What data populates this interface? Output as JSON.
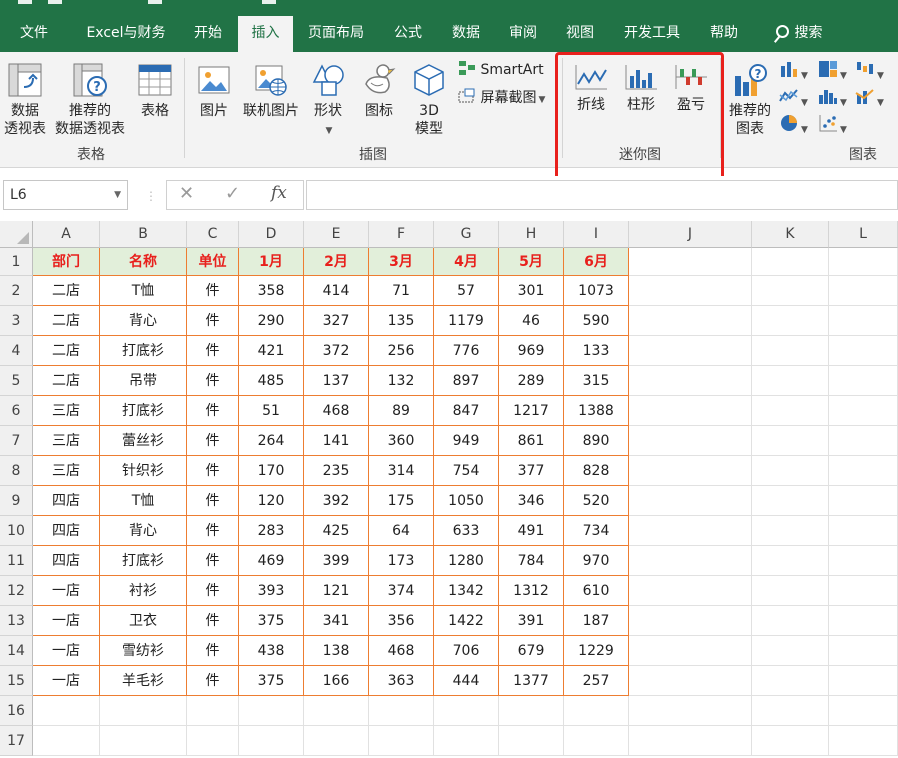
{
  "menu": {
    "tabs": [
      "文件",
      "Excel与财务",
      "开始",
      "插入",
      "页面布局",
      "公式",
      "数据",
      "审阅",
      "视图",
      "开发工具",
      "帮助",
      "搜索"
    ],
    "active_tab": "插入"
  },
  "ribbon": {
    "table_group": {
      "label": "表格",
      "pivot": "数据\n透视表",
      "recommended_pivot": "推荐的\n数据透视表",
      "table": "表格"
    },
    "illustrations_group": {
      "label": "插图",
      "picture": "图片",
      "online_picture": "联机图片",
      "shapes": "形状",
      "icons": "图标",
      "model3d": "3D\n模型",
      "smartart": "SmartArt",
      "screenshot": "屏幕截图"
    },
    "sparklines_group": {
      "label": "迷你图",
      "line": "折线",
      "column": "柱形",
      "winloss": "盈亏"
    },
    "charts_group": {
      "label": "图表",
      "recommended": "推荐的\n图表"
    }
  },
  "formula_bar": {
    "name_box": "L6",
    "fx": "fx",
    "cancel": "✕",
    "confirm": "✓",
    "value": ""
  },
  "sheet": {
    "columns": [
      "A",
      "B",
      "C",
      "D",
      "E",
      "F",
      "G",
      "H",
      "I",
      "J",
      "K",
      "L"
    ],
    "row_numbers": [
      "1",
      "2",
      "3",
      "4",
      "5",
      "6",
      "7",
      "8",
      "9",
      "10",
      "11",
      "12",
      "13",
      "14",
      "15",
      "16",
      "17"
    ],
    "header": [
      "部门",
      "名称",
      "单位",
      "1月",
      "2月",
      "3月",
      "4月",
      "5月",
      "6月"
    ],
    "rows": [
      [
        "二店",
        "T恤",
        "件",
        "358",
        "414",
        "71",
        "57",
        "301",
        "1073"
      ],
      [
        "二店",
        "背心",
        "件",
        "290",
        "327",
        "135",
        "1179",
        "46",
        "590"
      ],
      [
        "二店",
        "打底衫",
        "件",
        "421",
        "372",
        "256",
        "776",
        "969",
        "133"
      ],
      [
        "二店",
        "吊带",
        "件",
        "485",
        "137",
        "132",
        "897",
        "289",
        "315"
      ],
      [
        "三店",
        "打底衫",
        "件",
        "51",
        "468",
        "89",
        "847",
        "1217",
        "1388"
      ],
      [
        "三店",
        "蕾丝衫",
        "件",
        "264",
        "141",
        "360",
        "949",
        "861",
        "890"
      ],
      [
        "三店",
        "针织衫",
        "件",
        "170",
        "235",
        "314",
        "754",
        "377",
        "828"
      ],
      [
        "四店",
        "T恤",
        "件",
        "120",
        "392",
        "175",
        "1050",
        "346",
        "520"
      ],
      [
        "四店",
        "背心",
        "件",
        "283",
        "425",
        "64",
        "633",
        "491",
        "734"
      ],
      [
        "四店",
        "打底衫",
        "件",
        "469",
        "399",
        "173",
        "1280",
        "784",
        "970"
      ],
      [
        "一店",
        "衬衫",
        "件",
        "393",
        "121",
        "374",
        "1342",
        "1312",
        "610"
      ],
      [
        "一店",
        "卫衣",
        "件",
        "375",
        "341",
        "356",
        "1422",
        "391",
        "187"
      ],
      [
        "一店",
        "雪纺衫",
        "件",
        "438",
        "138",
        "468",
        "706",
        "679",
        "1229"
      ],
      [
        "一店",
        "羊毛衫",
        "件",
        "375",
        "166",
        "363",
        "444",
        "1377",
        "257"
      ]
    ]
  },
  "colors": {
    "accent": "#217346",
    "header_fill": "#e2efda",
    "header_text": "#e8201c",
    "border": "#ed7d31",
    "highlight": "#e8201c"
  }
}
